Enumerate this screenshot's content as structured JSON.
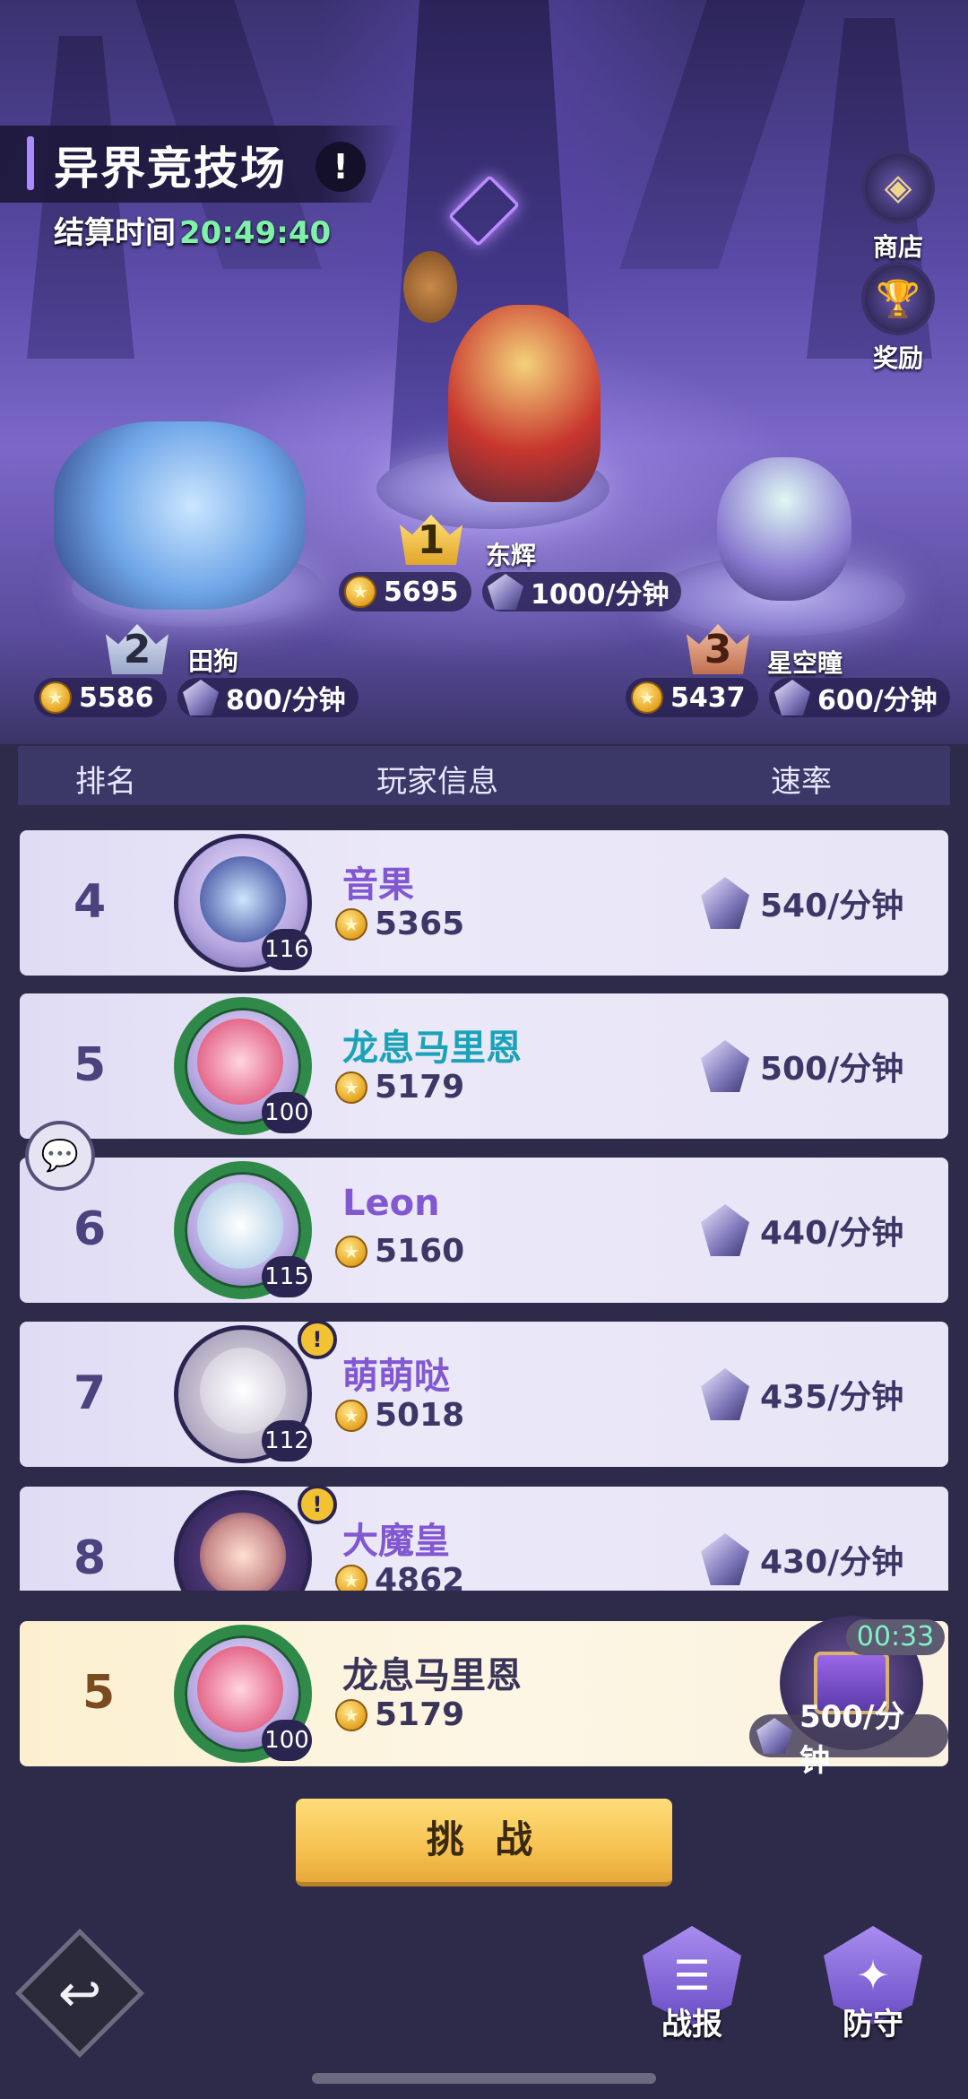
{
  "header": {
    "title": "异界竞技场",
    "info_icon": "exclamation-icon",
    "info_glyph": "!",
    "settle_label": "结算时间",
    "settle_time": "20:49:40"
  },
  "side_buttons": [
    {
      "label": "商店",
      "icon": "shop-icon"
    },
    {
      "label": "奖励",
      "icon": "trophy-icon"
    }
  ],
  "podium": [
    {
      "rank": "1",
      "name": "东辉",
      "score": "5695",
      "rate": "1000/分钟"
    },
    {
      "rank": "2",
      "name": "田狗",
      "score": "5586",
      "rate": "800/分钟"
    },
    {
      "rank": "3",
      "name": "星空瞳",
      "score": "5437",
      "rate": "600/分钟"
    }
  ],
  "table_header": {
    "rank": "排名",
    "player": "玩家信息",
    "rate": "速率"
  },
  "rows": [
    {
      "rank": "4",
      "name": "音果",
      "level": "116",
      "score": "5365",
      "rate": "540/分钟"
    },
    {
      "rank": "5",
      "name": "龙息马里恩",
      "level": "100",
      "score": "5179",
      "rate": "500/分钟"
    },
    {
      "rank": "6",
      "name": "Leon",
      "level": "115",
      "score": "5160",
      "rate": "440/分钟"
    },
    {
      "rank": "7",
      "name": "萌萌哒",
      "level": "112",
      "score": "5018",
      "rate": "435/分钟"
    },
    {
      "rank": "8",
      "name": "大魔皇",
      "level": "",
      "score": "4862",
      "rate": "430/分钟"
    }
  ],
  "my_row": {
    "rank": "5",
    "name": "龙息马里恩",
    "level": "100",
    "score": "5179",
    "rate": "500/分钟",
    "timer": "00:33"
  },
  "actions": {
    "challenge": "挑 战",
    "report": "战报",
    "defense": "防守"
  },
  "colors": {
    "accent": "#8157d2",
    "teal_name": "#1aa3b8",
    "timer": "#7ef3a8",
    "challenge": "#f6c251"
  }
}
